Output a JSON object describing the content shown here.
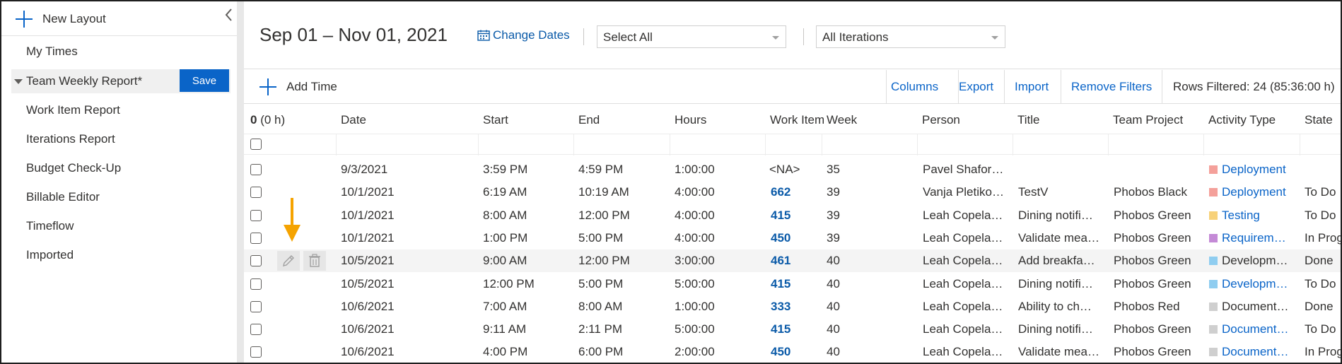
{
  "sidebar": {
    "new_layout_label": "New Layout",
    "items": [
      {
        "label": "My Times"
      },
      {
        "label": "Team Weekly Report*",
        "active": true
      },
      {
        "label": "Work Item Report"
      },
      {
        "label": "Iterations Report"
      },
      {
        "label": "Budget Check-Up"
      },
      {
        "label": "Billable Editor"
      },
      {
        "label": "Timeflow"
      },
      {
        "label": "Imported"
      }
    ],
    "save_label": "Save"
  },
  "topbar": {
    "date_range": "Sep 01 – Nov 01, 2021",
    "change_dates_label": "Change Dates",
    "filter1": "Select All",
    "filter2": "All Iterations"
  },
  "actions": {
    "add_time_label": "Add Time",
    "columns_label": "Columns",
    "export_label": "Export",
    "import_label": "Import",
    "remove_filters_label": "Remove Filters",
    "rows_filtered": "Rows Filtered: 24 (85:36:00 h)"
  },
  "table": {
    "selection_count": "0",
    "selection_hours": "(0 h)",
    "columns": [
      "Date",
      "Start",
      "End",
      "Hours",
      "Work Item",
      "Week",
      "Person",
      "Title",
      "Team Project",
      "Activity Type",
      "State"
    ],
    "rows": [
      {
        "date": "9/3/2021",
        "start": "3:59 PM",
        "end": "4:59 PM",
        "hours": "1:00:00",
        "work_item": "<NA>",
        "week": "35",
        "person": "Pavel Shafor…",
        "title": "",
        "project": "",
        "activity": "Deployment",
        "activity_color": "#f4a09a",
        "activity_link": true,
        "state": ""
      },
      {
        "date": "10/1/2021",
        "start": "6:19 AM",
        "end": "10:19 AM",
        "hours": "4:00:00",
        "work_item": "662",
        "week": "39",
        "person": "Vanja Pletiko…",
        "title": "TestV",
        "project": "Phobos Black",
        "activity": "Deployment",
        "activity_color": "#f4a09a",
        "activity_link": true,
        "state": "To Do"
      },
      {
        "date": "10/1/2021",
        "start": "8:00 AM",
        "end": "12:00 PM",
        "hours": "4:00:00",
        "work_item": "415",
        "week": "39",
        "person": "Leah Copela…",
        "title": "Dining notifi…",
        "project": "Phobos Green",
        "activity": "Testing",
        "activity_color": "#f7d179",
        "activity_link": true,
        "state": "To Do"
      },
      {
        "date": "10/1/2021",
        "start": "1:00 PM",
        "end": "5:00 PM",
        "hours": "4:00:00",
        "work_item": "450",
        "week": "39",
        "person": "Leah Copela…",
        "title": "Validate mea…",
        "project": "Phobos Green",
        "activity": "Requirem…",
        "activity_color": "#c48ad6",
        "activity_link": true,
        "state": "In Prog"
      },
      {
        "date": "10/5/2021",
        "start": "9:00 AM",
        "end": "12:00 PM",
        "hours": "3:00:00",
        "work_item": "461",
        "week": "40",
        "person": "Leah Copela…",
        "title": "Add breakfa…",
        "project": "Phobos Green",
        "activity": "Developm…",
        "activity_color": "#8fcdf0",
        "activity_link": false,
        "state": "Done",
        "hover": true
      },
      {
        "date": "10/5/2021",
        "start": "12:00 PM",
        "end": "5:00 PM",
        "hours": "5:00:00",
        "work_item": "415",
        "week": "40",
        "person": "Leah Copela…",
        "title": "Dining notifi…",
        "project": "Phobos Green",
        "activity": "Developm…",
        "activity_color": "#8fcdf0",
        "activity_link": true,
        "state": "To Do"
      },
      {
        "date": "10/6/2021",
        "start": "7:00 AM",
        "end": "8:00 AM",
        "hours": "1:00:00",
        "work_item": "333",
        "week": "40",
        "person": "Leah Copela…",
        "title": "Ability to ch…",
        "project": "Phobos Red",
        "activity": "Document…",
        "activity_color": "#cfcfcf",
        "activity_link": false,
        "state": "Done"
      },
      {
        "date": "10/6/2021",
        "start": "9:11 AM",
        "end": "2:11 PM",
        "hours": "5:00:00",
        "work_item": "415",
        "week": "40",
        "person": "Leah Copela…",
        "title": "Dining notifi…",
        "project": "Phobos Green",
        "activity": "Document…",
        "activity_color": "#cfcfcf",
        "activity_link": true,
        "state": "To Do"
      },
      {
        "date": "10/6/2021",
        "start": "4:00 PM",
        "end": "6:00 PM",
        "hours": "2:00:00",
        "work_item": "450",
        "week": "40",
        "person": "Leah Copela…",
        "title": "Validate mea…",
        "project": "Phobos Green",
        "activity": "Document…",
        "activity_color": "#cfcfcf",
        "activity_link": true,
        "state": "In Prog"
      }
    ]
  },
  "colors": {
    "accent": "#0a64c8",
    "link": "#0a5aa8",
    "arrow": "#f5a300"
  },
  "icons": {
    "new_layout": "plus-icon",
    "collapse": "chevron-left-icon",
    "calendar": "calendar-icon",
    "edit": "pencil-icon",
    "delete": "trash-icon",
    "annotation": "down-arrow-icon"
  }
}
